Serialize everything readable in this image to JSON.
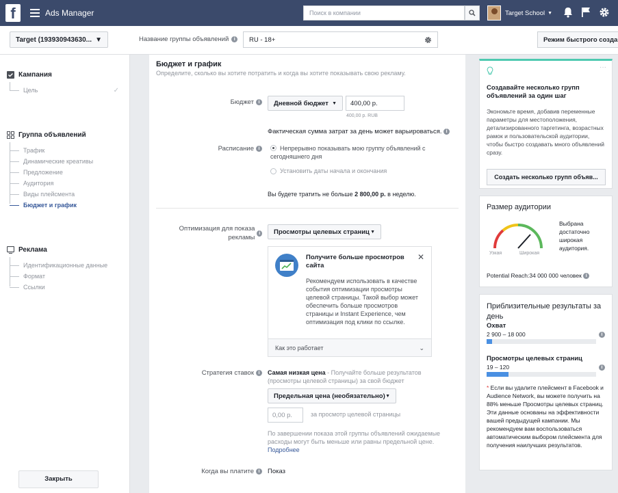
{
  "topbar": {
    "logo": "f",
    "app_name": "Ads Manager",
    "search_placeholder": "Поиск в компании",
    "user_name": "Target School"
  },
  "selector": {
    "campaign": "Target (193930943630...",
    "adgroup_label": "Название группы объявлений",
    "adgroup_value": "RU - 18+",
    "quick_create": "Режим быстрого создания"
  },
  "sidebar": {
    "campaign": {
      "title": "Кампания",
      "items": [
        "Цель"
      ]
    },
    "adgroup": {
      "title": "Группа объявлений",
      "items": [
        "Трафик",
        "Динамические креативы",
        "Предложение",
        "Аудитория",
        "Виды плейсмента",
        "Бюджет и график"
      ],
      "active_index": 5
    },
    "ad": {
      "title": "Реклама",
      "items": [
        "Идентификационные данные",
        "Формат",
        "Ссылки"
      ]
    },
    "close": "Закрыть"
  },
  "main": {
    "title": "Бюджет и график",
    "subtitle": "Определите, сколько вы хотите потратить и когда вы хотите показывать свою рекламу.",
    "budget_label": "Бюджет",
    "budget_type": "Дневной бюджет",
    "budget_value": "400,00 р.",
    "budget_note": "400,00 р. RUB",
    "actual_note": "Фактическая сумма затрат за день может варьироваться.",
    "schedule_label": "Расписание",
    "schedule_opt1": "Непрерывно показывать мою группу объявлений с сегодняшнего дня",
    "schedule_opt2": "Установить даты начала и окончания",
    "spend_prefix": "Вы будете тратить не больше ",
    "spend_amount": "2 800,00 р.",
    "spend_suffix": " в неделю.",
    "optimization_label": "Оптимизация для показа рекламы",
    "optimization_value": "Просмотры целевых страниц",
    "reco_title": "Получите больше просмотров сайта",
    "reco_body": "Рекомендуем использовать в качестве события оптимизации просмотры целевой страницы. Такой выбор может обеспечить больше просмотров страницы и Instant Experience, чем оптимизация под клики по ссылке.",
    "reco_foot": "Как это работает",
    "bid_label": "Стратегия ставок",
    "bid_strategy_bold": "Самая низкая цена",
    "bid_strategy_rest": " - Получайте больше результатов (просмотры целевой страницы) за свой бюджет",
    "bid_cap_dropdown": "Предельная цена (необязательно)",
    "bid_cap_placeholder": "0,00 р.",
    "bid_cap_suffix": "за просмотр целевой страницы",
    "bid_note": "По завершении показа этой группы объявлений ожидаемые расходы могут быть меньше или равны предельной цене.",
    "bid_more": "Подробнее",
    "pay_label": "Когда вы платите",
    "pay_value": "Показ"
  },
  "right": {
    "tip_title": "Создавайте несколько групп объявлений за один шаг",
    "tip_body": "Экономьте время, добавив переменные параметры для местоположения, детализированного таргетинга, возрастных рамок и пользовательской аудитории, чтобы быстро создавать много объявлений сразу.",
    "tip_button": "Создать несколько групп объяв...",
    "audience_title": "Размер аудитории",
    "audience_desc": "Выбрана достаточно широкая аудитория.",
    "gauge_narrow": "Узкая",
    "gauge_wide": "Широкая",
    "potential_reach": "Potential Reach:34 000 000 человек",
    "results_title": "Приблизительные результаты за день",
    "reach_label": "Охват",
    "reach_value": "2 900 – 18 000",
    "reach_fill": 0.05,
    "views_label": "Просмотры целевых страниц",
    "views_value": "19 – 120",
    "views_fill": 0.2,
    "results_note": "Если вы удалите плейсмент в Facebook и Audience Network, вы можете получить на 88% меньше Просмотры целевых страниц. Эти данные основаны на эффективности вашей предыдущей кампании. Мы рекомендуем вам воспользоваться автоматическим выбором плейсмента для получения наилучших результатов.",
    "accent_color": "#4ec9b0"
  }
}
